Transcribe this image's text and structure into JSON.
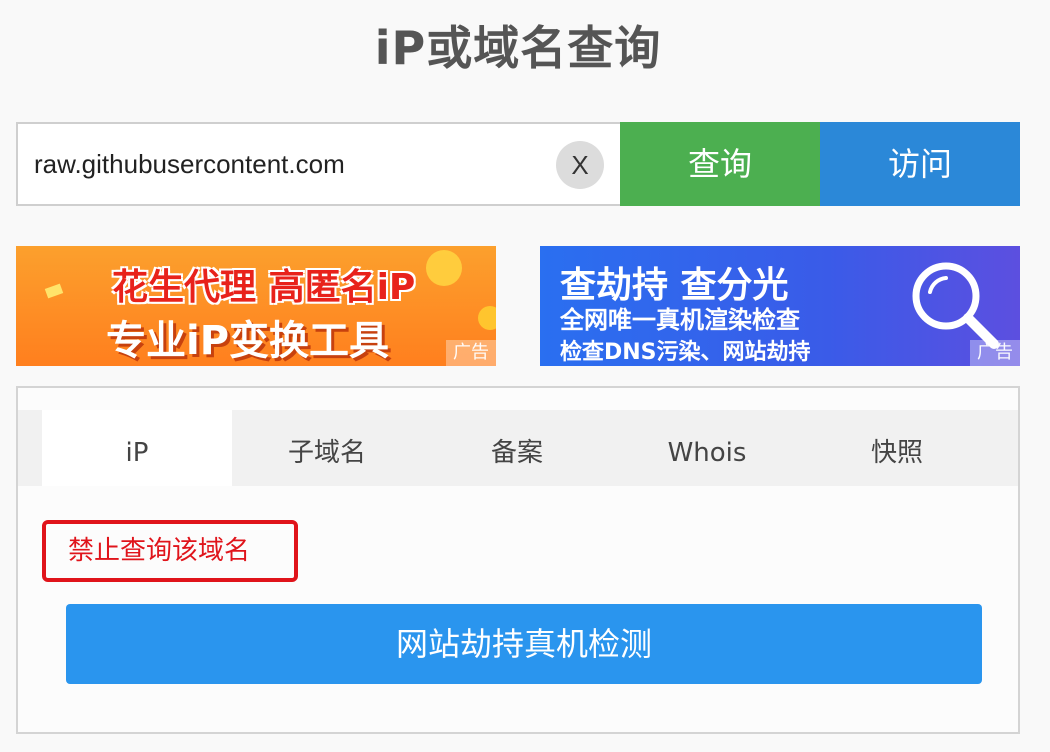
{
  "header": {
    "title": "iP或域名查询"
  },
  "search": {
    "value": "raw.githubusercontent.com",
    "clear_label": "X",
    "query_label": "查询",
    "visit_label": "访问"
  },
  "ads": {
    "left": {
      "line1_a": "花生代理",
      "line1_b": "高匿名iP",
      "line2": "专业iP变换工具",
      "tag": "广告"
    },
    "right": {
      "line1": "查劫持 查分光",
      "line2": "全网唯一真机渲染检查",
      "line3": "检查DNS污染、网站劫持",
      "tag": "广告"
    }
  },
  "tabs": [
    {
      "label": "iP",
      "active": true
    },
    {
      "label": "子域名"
    },
    {
      "label": "备案"
    },
    {
      "label": "Whois"
    },
    {
      "label": "快照"
    }
  ],
  "result": {
    "notice": "禁止查询该域名",
    "check_button": "网站劫持真机检测"
  },
  "colors": {
    "query_green": "#4caf50",
    "visit_blue": "#2b88d8",
    "check_blue": "#2a95ee",
    "notice_red": "#e0141b"
  }
}
